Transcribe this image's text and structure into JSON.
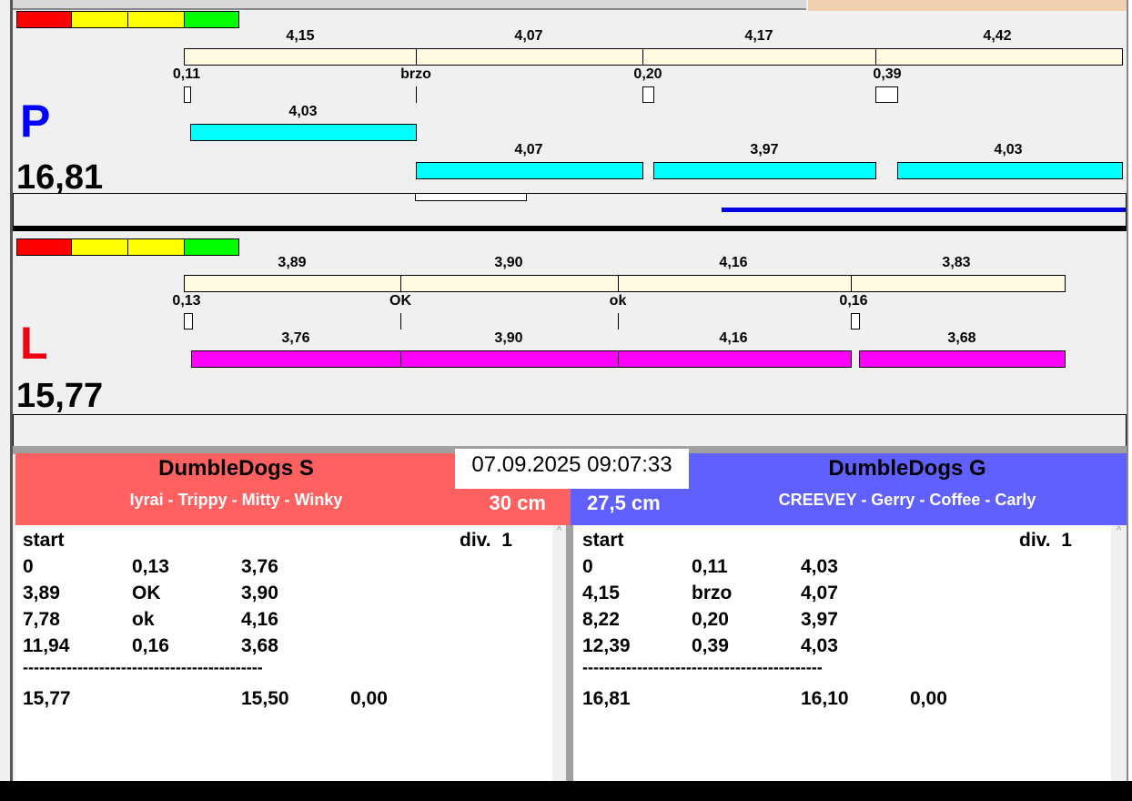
{
  "colors": {
    "cream": "#fffbe0",
    "cyan": "#00ffff",
    "magenta": "#ff00ff",
    "red_team": "#ff6060",
    "blue_team": "#6060ff"
  },
  "lane_p": {
    "letter": "P",
    "total": "16,81",
    "segments": [
      "4,15",
      "4,07",
      "4,17",
      "4,42"
    ],
    "markers": [
      "0,11",
      "brzo",
      "0,20",
      "0,39"
    ],
    "run_top": [
      "4,03"
    ],
    "run_bottom": [
      "4,07",
      "3,97",
      "4,03"
    ]
  },
  "lane_l": {
    "letter": "L",
    "total": "15,77",
    "segments": [
      "3,89",
      "3,90",
      "4,16",
      "3,83"
    ],
    "markers": [
      "0,13",
      "OK",
      "ok",
      "0,16"
    ],
    "run": [
      "3,76",
      "3,90",
      "4,16",
      "3,68"
    ]
  },
  "datetime": "07.09.2025 09:07:33",
  "left_team": {
    "name": "DumbleDogs S",
    "dogs": "Iyrai - Trippy - Mitty - Winky",
    "height": "30 cm",
    "start": "start",
    "div": "div.  1",
    "rows": [
      [
        "0",
        "0,13",
        "3,76"
      ],
      [
        "3,89",
        "OK",
        "3,90"
      ],
      [
        "7,78",
        "ok",
        "4,16"
      ],
      [
        "11,94",
        "0,16",
        "3,68"
      ]
    ],
    "dashes": "--------------------------------------------",
    "totals": [
      "15,77",
      "15,50",
      "0,00"
    ]
  },
  "right_team": {
    "name": "DumbleDogs G",
    "dogs": "CREEVEY - Gerry - Coffee - Carly",
    "height": "27,5 cm",
    "start": "start",
    "div": "div.  1",
    "rows": [
      [
        "0",
        "0,11",
        "4,03"
      ],
      [
        "4,15",
        "brzo",
        "4,07"
      ],
      [
        "8,22",
        "0,20",
        "3,97"
      ],
      [
        "12,39",
        "0,39",
        "4,03"
      ]
    ],
    "dashes": "--------------------------------------------",
    "totals": [
      "16,81",
      "16,10",
      "0,00"
    ]
  }
}
